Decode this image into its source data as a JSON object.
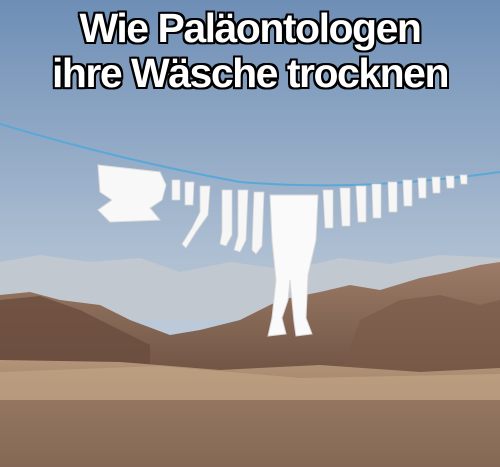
{
  "meme": {
    "caption_line1": "Wie Paläontologen",
    "caption_line2": "ihre Wäsche trocknen"
  },
  "colors": {
    "sky_top": "#6f8fb8",
    "sky_bottom": "#c9d5e0",
    "mountain": "#8a6a58",
    "desert": "#a0826a",
    "laundry": "#ffffff",
    "line": "#5aa8d8"
  }
}
